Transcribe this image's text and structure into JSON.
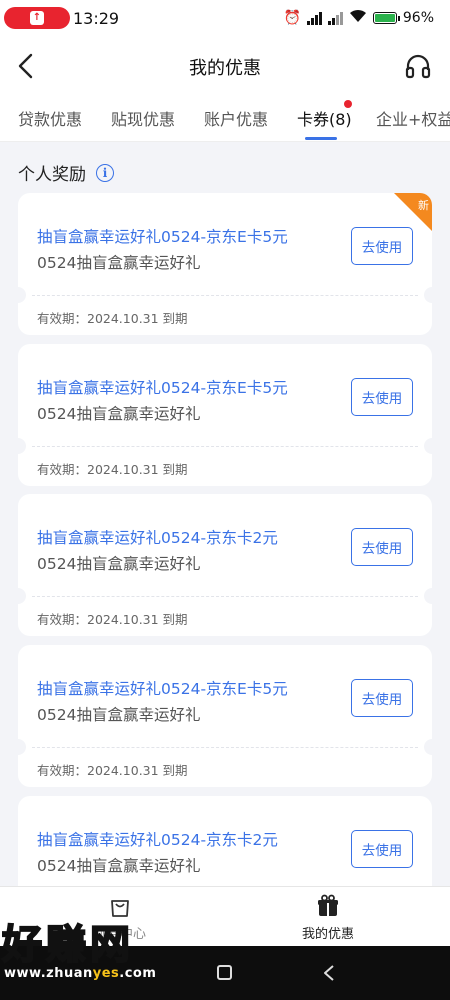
{
  "status_bar": {
    "time": "13:29",
    "battery": "96%"
  },
  "header": {
    "title": "我的优惠"
  },
  "tabs": [
    {
      "label": "贷款优惠",
      "active": false
    },
    {
      "label": "贴现优惠",
      "active": false
    },
    {
      "label": "账户优惠",
      "active": false
    },
    {
      "label": "卡券(8)",
      "active": true
    },
    {
      "label": "企业+权益",
      "active": false
    }
  ],
  "section": {
    "title": "个人奖励",
    "info_icon": "i"
  },
  "coupons": [
    {
      "title": "抽盲盒赢幸运好礼0524-京东E卡5元",
      "desc": "0524抽盲盒赢幸运好礼",
      "button": "去使用",
      "expiry": "有效期：2024.10.31 到期",
      "badge": "新"
    },
    {
      "title": "抽盲盒赢幸运好礼0524-京东E卡5元",
      "desc": "0524抽盲盒赢幸运好礼",
      "button": "去使用",
      "expiry": "有效期：2024.10.31 到期"
    },
    {
      "title": "抽盲盒赢幸运好礼0524-京东卡2元",
      "desc": "0524抽盲盒赢幸运好礼",
      "button": "去使用",
      "expiry": "有效期：2024.10.31 到期"
    },
    {
      "title": "抽盲盒赢幸运好礼0524-京东E卡5元",
      "desc": "0524抽盲盒赢幸运好礼",
      "button": "去使用",
      "expiry": "有效期：2024.10.31 到期"
    },
    {
      "title": "抽盲盒赢幸运好礼0524-京东卡2元",
      "desc": "0524抽盲盒赢幸运好礼",
      "button": "去使用",
      "expiry": ""
    }
  ],
  "bottom_nav": [
    {
      "label": "领券中心",
      "icon": "shopping-bag-icon",
      "active": false
    },
    {
      "label": "我的优惠",
      "icon": "gift-icon",
      "active": true
    }
  ],
  "watermark": {
    "brand": "好赚网",
    "url_prefix": "www.zhuan",
    "url_highlight": "yes",
    "url_suffix": ".com"
  },
  "colors": {
    "accent": "#3a72e6",
    "badge": "#f4891f",
    "dot": "#e8242f"
  }
}
